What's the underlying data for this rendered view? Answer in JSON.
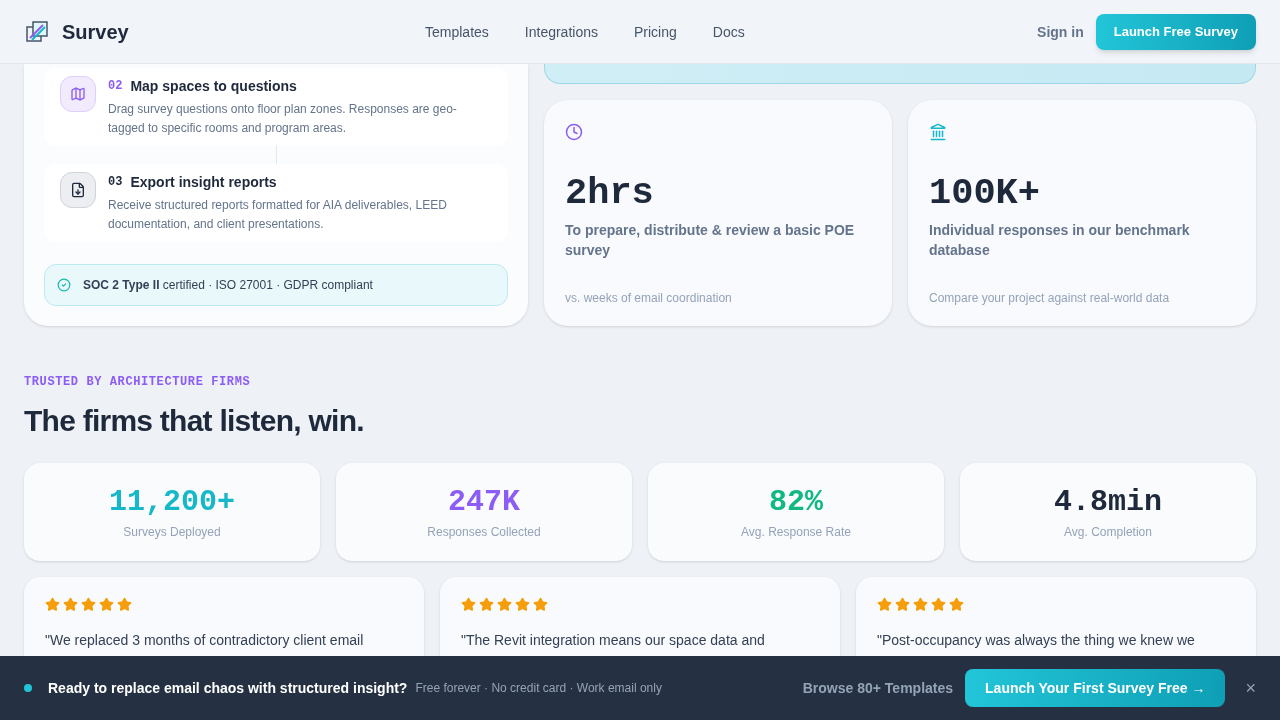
{
  "header": {
    "brand": "Survey",
    "nav": [
      {
        "label": "Templates"
      },
      {
        "label": "Integrations"
      },
      {
        "label": "Pricing"
      },
      {
        "label": "Docs"
      }
    ],
    "sign_in": "Sign in",
    "cta": "Launch Free Survey"
  },
  "steps": [
    {
      "number": "02",
      "title": "Map spaces to questions",
      "description": "Drag survey questions onto floor plan zones. Responses are geo-tagged to specific rooms and program areas.",
      "kind": "map"
    },
    {
      "number": "03",
      "title": "Export insight reports",
      "description": "Receive structured reports formatted for AIA deliverables, LEED documentation, and client presentations.",
      "kind": "export"
    }
  ],
  "certification": "**SOC 2 Type II** certified · ISO 27001 · GDPR compliant",
  "highlights": [
    {
      "kind": "clock",
      "value": "2hrs",
      "label": "To prepare, distribute & review a basic POE survey",
      "note": "vs. weeks of email coordination"
    },
    {
      "kind": "building",
      "value": "100K+",
      "label": "Individual responses in our benchmark database",
      "note": "Compare your project against real-world data"
    }
  ],
  "trusted": {
    "eyebrow": "TRUSTED BY ARCHITECTURE FIRMS",
    "heading": "The firms that listen, win."
  },
  "stats": [
    {
      "value": "11,200+",
      "label": "Surveys Deployed",
      "color": "#14b8c8"
    },
    {
      "value": "247K",
      "label": "Responses Collected",
      "color": "#8b5cf6"
    },
    {
      "value": "82%",
      "label": "Avg. Response Rate",
      "color": "#10b981"
    },
    {
      "value": "4.8min",
      "label": "Avg. Completion",
      "color": "#1e293b"
    }
  ],
  "testimonials": [
    {
      "stars": 5,
      "quote": "\"We replaced 3 months of contradictory client email"
    },
    {
      "stars": 5,
      "quote": "\"The Revit integration means our space data and"
    },
    {
      "stars": 5,
      "quote": "\"Post-occupancy was always the thing we knew we"
    }
  ],
  "banner": {
    "message": "Ready to replace email chaos with structured insight?",
    "details": "Free forever · No credit card · Work email only",
    "browse": "Browse 80+ Templates",
    "cta": "Launch Your First Survey Free →",
    "close": "×"
  }
}
